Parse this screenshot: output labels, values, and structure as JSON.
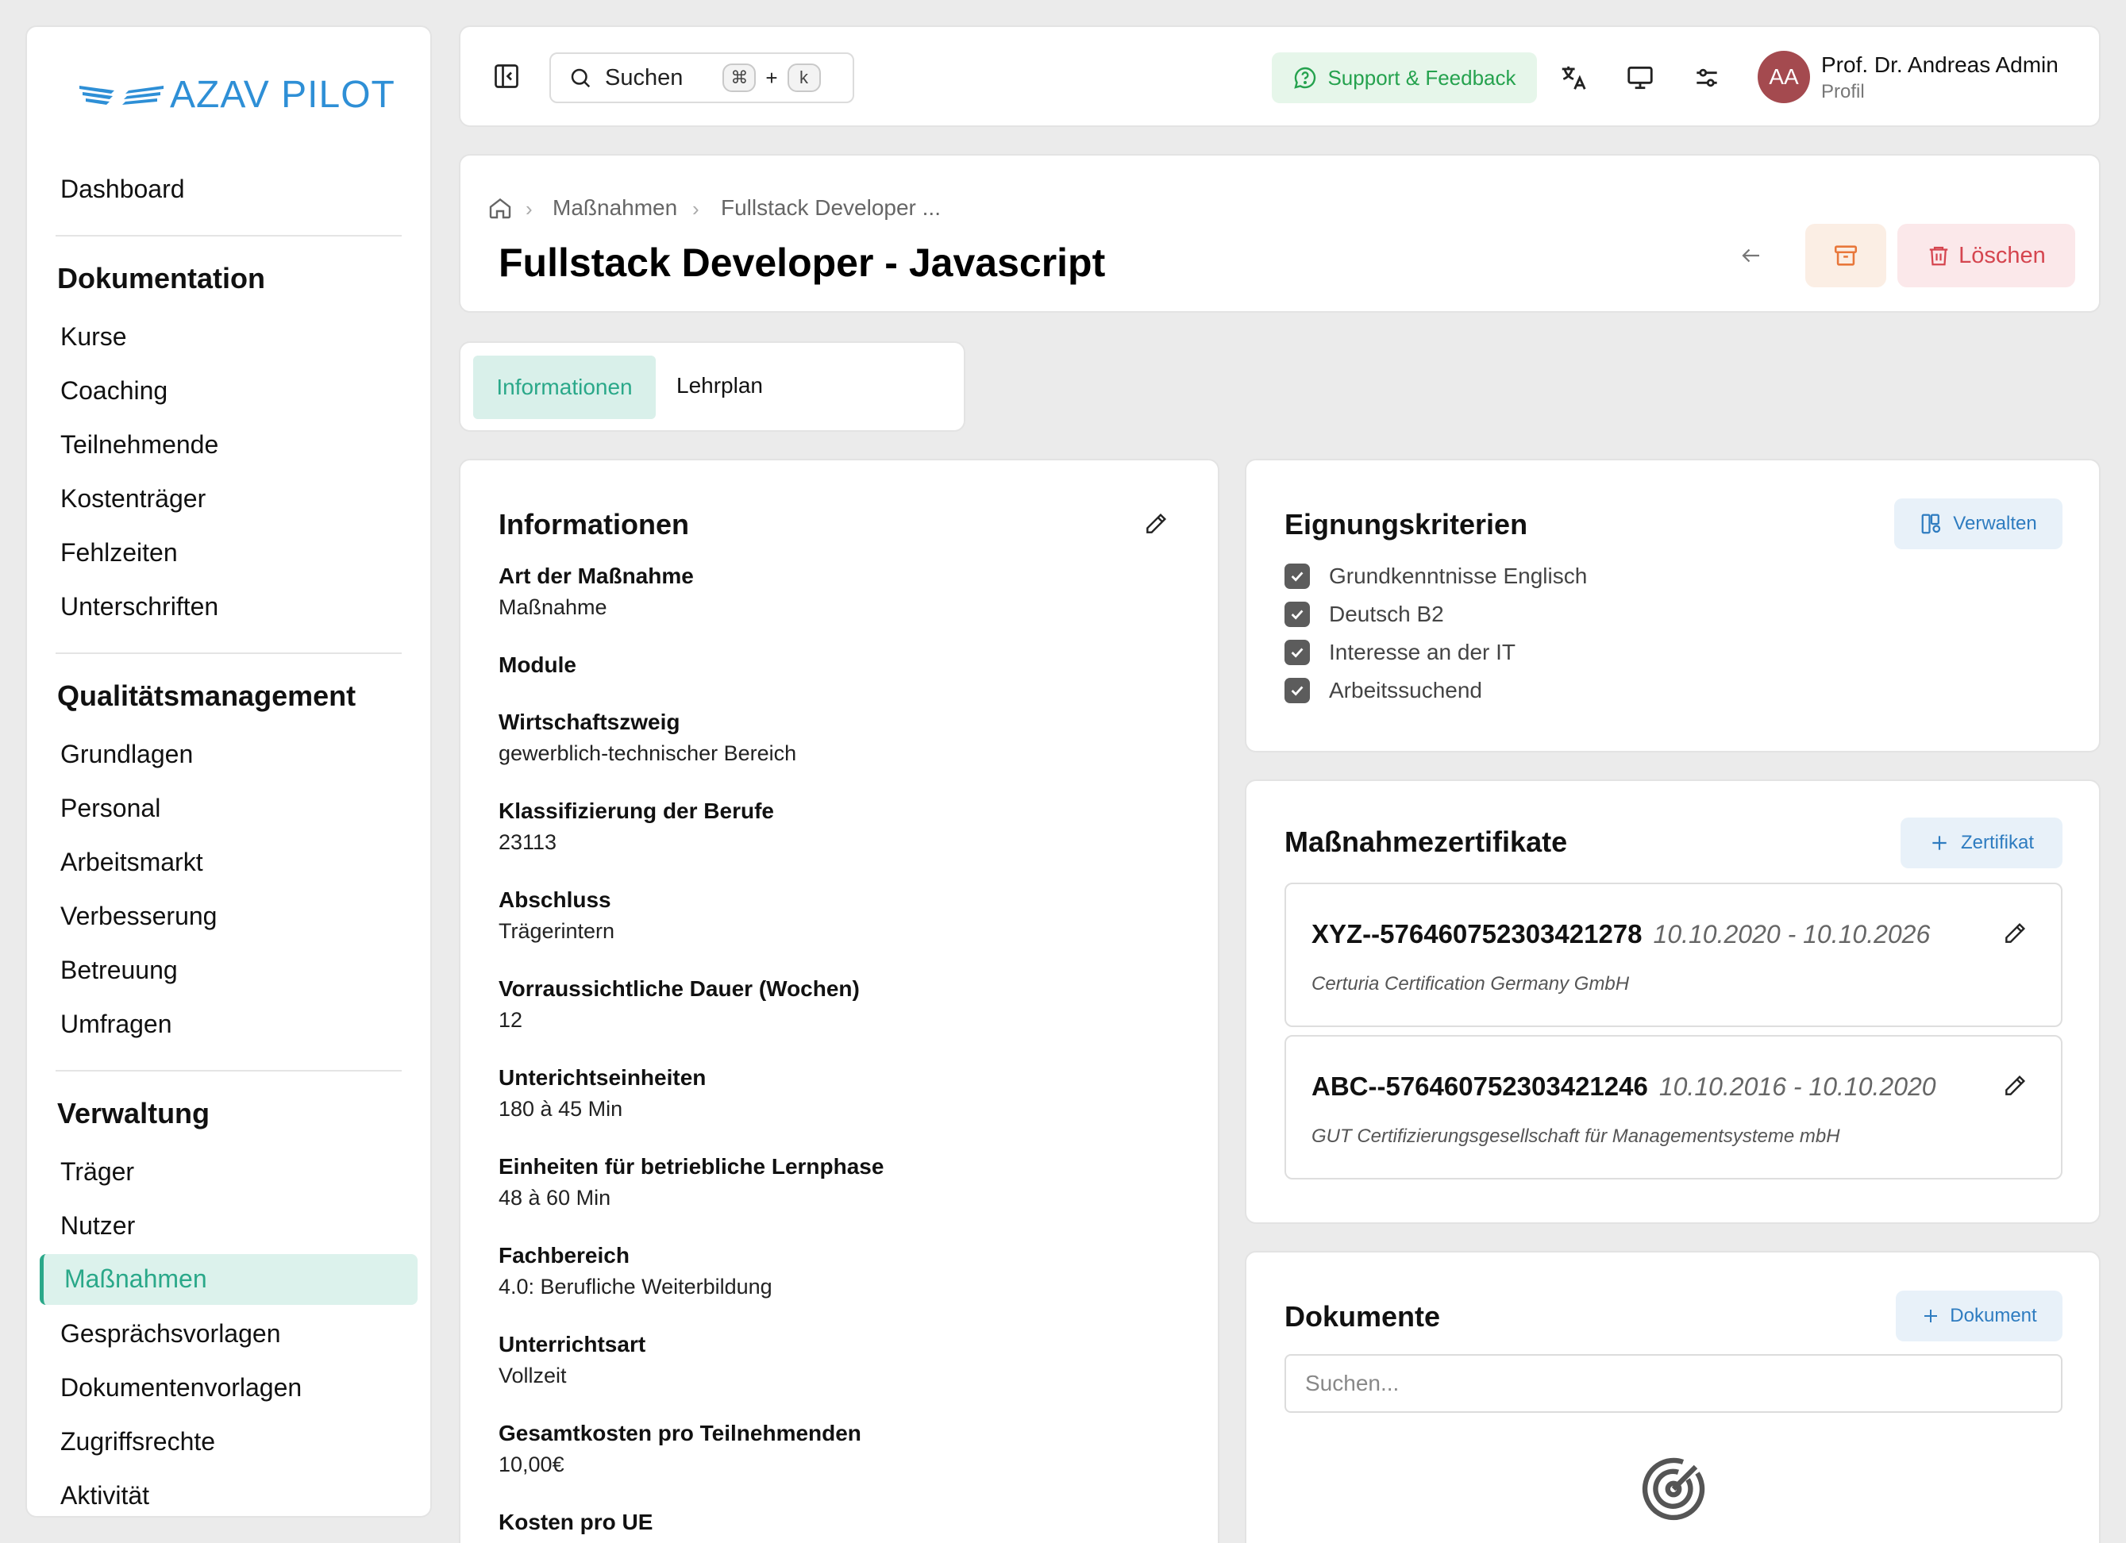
{
  "brand": {
    "name": "AZAV PILOT",
    "color": "#2e8fd6"
  },
  "sidebar": {
    "dashboard": "Dashboard",
    "sections": [
      {
        "title": "Dokumentation",
        "items": [
          "Kurse",
          "Coaching",
          "Teilnehmende",
          "Kostenträger",
          "Fehlzeiten",
          "Unterschriften"
        ]
      },
      {
        "title": "Qualitätsmanagement",
        "items": [
          "Grundlagen",
          "Personal",
          "Arbeitsmarkt",
          "Verbesserung",
          "Betreuung",
          "Umfragen"
        ]
      },
      {
        "title": "Verwaltung",
        "items": [
          "Träger",
          "Nutzer",
          "Maßnahmen",
          "Gesprächsvorlagen",
          "Dokumentenvorlagen",
          "Zugriffsrechte",
          "Aktivität"
        ]
      }
    ],
    "active_item": "Maßnahmen"
  },
  "topbar": {
    "search_label": "Suchen",
    "shortcut_cmd": "⌘",
    "shortcut_plus": "+",
    "shortcut_key": "k",
    "support_label": "Support & Feedback",
    "user": {
      "initials": "AA",
      "name": "Prof. Dr. Andreas Admin",
      "subtitle": "Profil"
    }
  },
  "header": {
    "breadcrumb": [
      "Maßnahmen",
      "Fullstack Developer ..."
    ],
    "title": "Fullstack Developer - Javascript",
    "delete_label": "Löschen"
  },
  "tabs": [
    "Informationen",
    "Lehrplan"
  ],
  "info": {
    "title": "Informationen",
    "fields": [
      {
        "label": "Art der Maßnahme",
        "value": "Maßnahme"
      },
      {
        "label": "Module",
        "value": ""
      },
      {
        "label": "Wirtschaftszweig",
        "value": "gewerblich-technischer Bereich"
      },
      {
        "label": "Klassifizierung der Berufe",
        "value": "23113"
      },
      {
        "label": "Abschluss",
        "value": "Trägerintern"
      },
      {
        "label": "Vorraussichtliche Dauer (Wochen)",
        "value": "12"
      },
      {
        "label": "Unterichtseinheiten",
        "value": "180 à 45 Min"
      },
      {
        "label": "Einheiten für betriebliche Lernphase",
        "value": "48 à 60 Min"
      },
      {
        "label": "Fachbereich",
        "value": "4.0: Berufliche Weiterbildung"
      },
      {
        "label": "Unterrichtsart",
        "value": "Vollzeit"
      },
      {
        "label": "Gesamtkosten pro Teilnehmenden",
        "value": "10,00€"
      },
      {
        "label": "Kosten pro UE",
        "value": ""
      }
    ]
  },
  "criteria": {
    "title": "Eignungskriterien",
    "manage_label": "Verwalten",
    "items": [
      "Grundkenntnisse Englisch",
      "Deutsch B2",
      "Interesse an der IT",
      "Arbeitssuchend"
    ]
  },
  "certificates": {
    "title": "Maßnahmezertifikate",
    "add_label": "Zertifikat",
    "items": [
      {
        "code": "XYZ--576460752303421278",
        "dates": "10.10.2020 - 10.10.2026",
        "org": "Certuria Certification Germany GmbH"
      },
      {
        "code": "ABC--576460752303421246",
        "dates": "10.10.2016 - 10.10.2020",
        "org": "GUT Certifizierungsgesellschaft für Managementsysteme mbH"
      }
    ]
  },
  "documents": {
    "title": "Dokumente",
    "add_label": "Dokument",
    "search_placeholder": "Suchen..."
  },
  "colors": {
    "accent": "#2aa889",
    "delete": "#d5454f",
    "support": "#25a24e",
    "avatar": "#a44a4f"
  }
}
